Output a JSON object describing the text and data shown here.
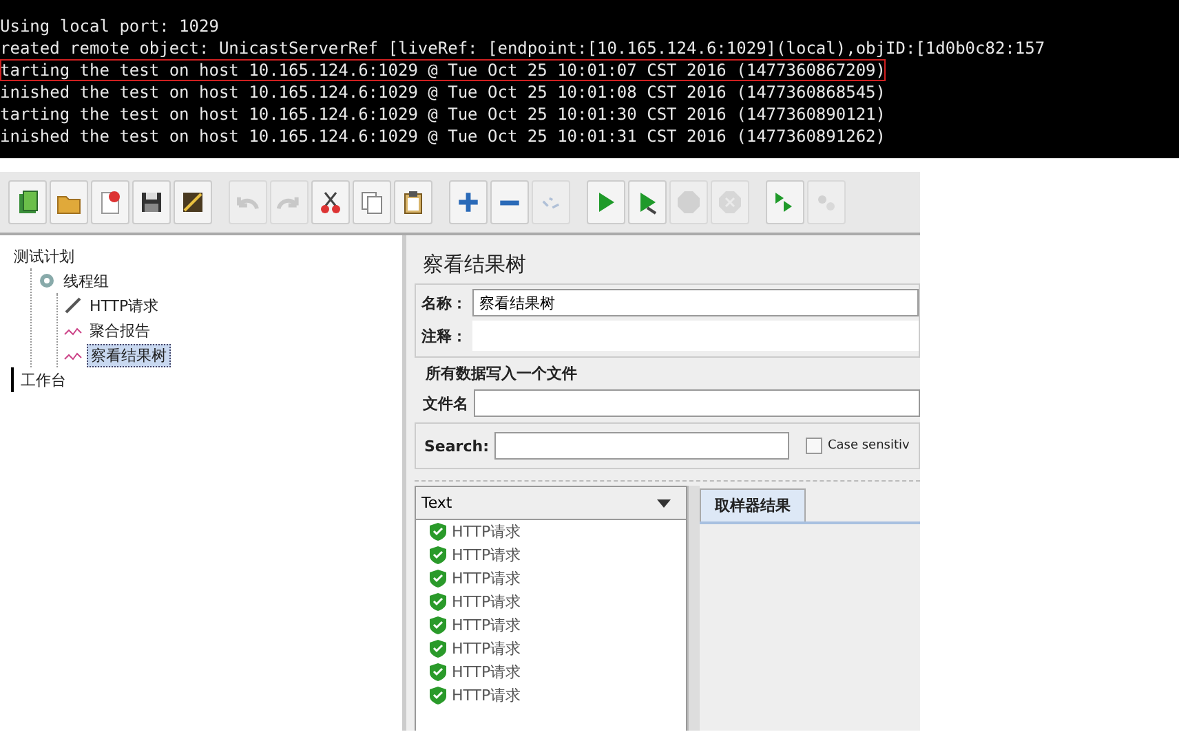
{
  "console": {
    "lines": [
      {
        "text": "Using local port: 1029",
        "highlighted": false
      },
      {
        "text": "reated remote object: UnicastServerRef [liveRef: [endpoint:[10.165.124.6:1029](local),objID:[1d0b0c82:157",
        "highlighted": false
      },
      {
        "text": "tarting the test on host 10.165.124.6:1029 @ Tue Oct 25 10:01:07 CST 2016 (1477360867209)",
        "highlighted": true
      },
      {
        "text": "inished the test on host 10.165.124.6:1029 @ Tue Oct 25 10:01:08 CST 2016 (1477360868545)",
        "highlighted": false
      },
      {
        "text": "tarting the test on host 10.165.124.6:1029 @ Tue Oct 25 10:01:30 CST 2016 (1477360890121)",
        "highlighted": false
      },
      {
        "text": "inished the test on host 10.165.124.6:1029 @ Tue Oct 25 10:01:31 CST 2016 (1477360891262)",
        "highlighted": false
      }
    ]
  },
  "toolbar": [
    {
      "kind": "templates",
      "disabled": false,
      "group_start": true
    },
    {
      "kind": "open",
      "disabled": false,
      "group_start": false
    },
    {
      "kind": "close",
      "disabled": false,
      "group_start": false
    },
    {
      "kind": "save",
      "disabled": false,
      "group_start": false
    },
    {
      "kind": "save-image",
      "disabled": false,
      "group_start": false
    },
    {
      "kind": "undo",
      "disabled": true,
      "group_start": true
    },
    {
      "kind": "redo",
      "disabled": true,
      "group_start": false
    },
    {
      "kind": "cut",
      "disabled": false,
      "group_start": false
    },
    {
      "kind": "copy",
      "disabled": false,
      "group_start": false
    },
    {
      "kind": "paste",
      "disabled": false,
      "group_start": false
    },
    {
      "kind": "expand",
      "disabled": false,
      "group_start": true
    },
    {
      "kind": "collapse",
      "disabled": false,
      "group_start": false
    },
    {
      "kind": "toggle",
      "disabled": true,
      "group_start": false
    },
    {
      "kind": "start",
      "disabled": false,
      "group_start": true
    },
    {
      "kind": "start-no-pauses",
      "disabled": false,
      "group_start": false
    },
    {
      "kind": "stop",
      "disabled": true,
      "group_start": false
    },
    {
      "kind": "shutdown",
      "disabled": true,
      "group_start": false
    },
    {
      "kind": "remote-start",
      "disabled": false,
      "group_start": true
    },
    {
      "kind": "remote-clear",
      "disabled": true,
      "group_start": false
    }
  ],
  "tree": [
    {
      "label": "测试计划",
      "kind": "plan",
      "selected": false,
      "children": [
        {
          "label": "线程组",
          "kind": "thread-group",
          "selected": false,
          "children": [
            {
              "label": "HTTP请求",
              "kind": "sampler",
              "selected": false
            },
            {
              "label": "聚合报告",
              "kind": "listener",
              "selected": false
            },
            {
              "label": "察看结果树",
              "kind": "listener",
              "selected": true
            }
          ]
        }
      ]
    },
    {
      "label": "工作台",
      "kind": "workbench",
      "selected": false
    }
  ],
  "panel": {
    "title": "察看结果树",
    "name_label": "名称：",
    "name_value": "察看结果树",
    "comment_label": "注释：",
    "file_group": "所有数据写入一个文件",
    "filename_label": "文件名",
    "search_label": "Search:",
    "case_sensitive": {
      "label": "Case sensitiv",
      "checked": false
    },
    "renderer": "Text",
    "results": [
      {
        "label": "HTTP请求",
        "success": true
      },
      {
        "label": "HTTP请求",
        "success": true
      },
      {
        "label": "HTTP请求",
        "success": true
      },
      {
        "label": "HTTP请求",
        "success": true
      },
      {
        "label": "HTTP请求",
        "success": true
      },
      {
        "label": "HTTP请求",
        "success": true
      },
      {
        "label": "HTTP请求",
        "success": true
      },
      {
        "label": "HTTP请求",
        "success": true
      }
    ],
    "tabs": [
      {
        "label": "取样器结果",
        "selected": true
      }
    ]
  }
}
